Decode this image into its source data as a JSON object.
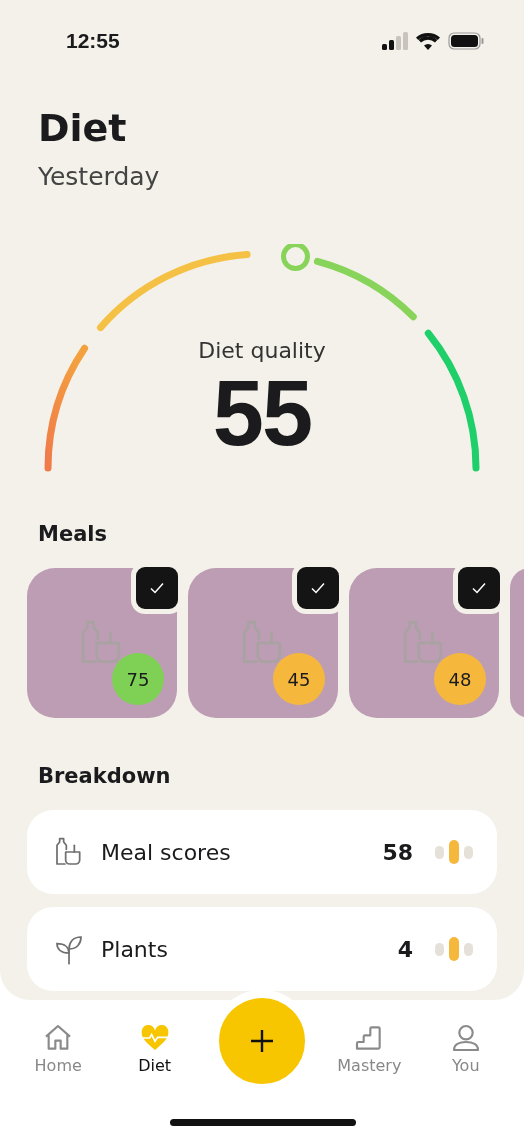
{
  "status_bar": {
    "time": "12:55"
  },
  "header": {
    "title": "Diet",
    "subtitle": "Yesterday"
  },
  "gauge": {
    "label": "Diet quality",
    "value": "55"
  },
  "meals": {
    "title": "Meals",
    "items": [
      {
        "score": "75",
        "color": "#7fd155",
        "logged": true
      },
      {
        "score": "45",
        "color": "#f5b83d",
        "logged": true
      },
      {
        "score": "48",
        "color": "#f5b83d",
        "logged": true
      }
    ]
  },
  "breakdown": {
    "title": "Breakdown",
    "items": [
      {
        "kind": "meal",
        "label": "Meal scores",
        "value": "58"
      },
      {
        "kind": "plant",
        "label": "Plants",
        "value": "4"
      }
    ]
  },
  "tabs": [
    {
      "kind": "home",
      "label": "Home",
      "selected": false
    },
    {
      "kind": "diet",
      "label": "Diet",
      "selected": true
    },
    {
      "kind": "add"
    },
    {
      "kind": "mastery",
      "label": "Mastery",
      "selected": false
    },
    {
      "kind": "you",
      "label": "You",
      "selected": false
    }
  ]
}
